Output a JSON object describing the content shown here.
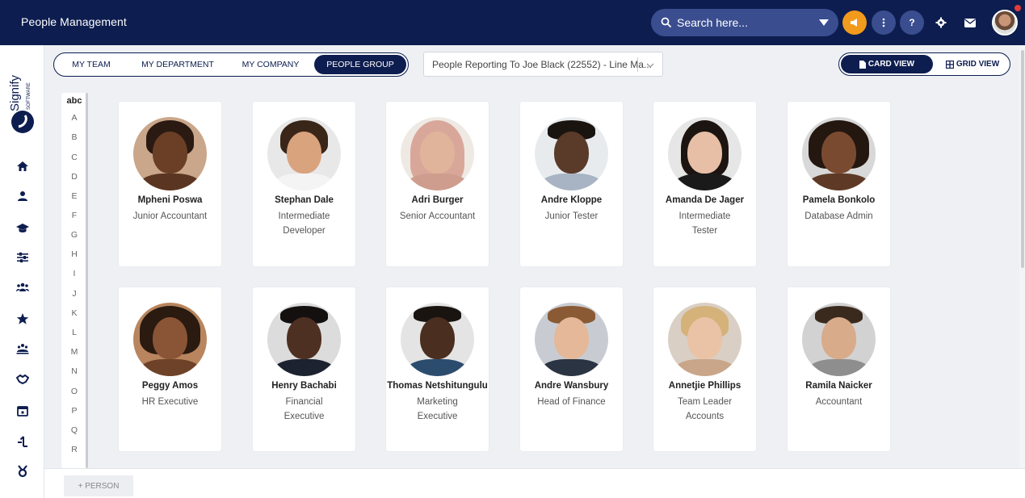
{
  "header": {
    "app_title": "People Management",
    "search_label": "Search here...",
    "colors": {
      "bar": "#0d1d4f",
      "search": "#3a4d8f",
      "accent": "#f29a1c",
      "circle": "#3a4d8f"
    },
    "icons": [
      "megaphone-icon",
      "more-vertical-icon",
      "help-icon",
      "gear-icon",
      "mail-icon"
    ]
  },
  "sidebar": {
    "logo_text": "Signify",
    "logo_sub": "SOFTWARE",
    "icons": [
      "home-icon",
      "person-icon",
      "graduation-cap-icon",
      "sliders-icon",
      "group-icon",
      "star-icon",
      "org-icon",
      "handshake-icon",
      "calendar-icon",
      "transfer-icon",
      "award-icon"
    ]
  },
  "tabs": [
    {
      "label": "MY TEAM"
    },
    {
      "label": "MY DEPARTMENT"
    },
    {
      "label": "MY COMPANY"
    },
    {
      "label": "PEOPLE GROUP",
      "active": true
    }
  ],
  "dropdown": {
    "value": "People Reporting To Joe Black (22552) - Line Ma..."
  },
  "view_toggle": {
    "card_view": "CARD VIEW",
    "grid_view": "GRID VIEW",
    "active": "card"
  },
  "alphabet": {
    "header": "abc",
    "letters": [
      "A",
      "B",
      "C",
      "D",
      "E",
      "F",
      "G",
      "H",
      "I",
      "J",
      "K",
      "L",
      "M",
      "N",
      "O",
      "P",
      "Q",
      "R"
    ]
  },
  "people": [
    {
      "name": "Mpheni Poswa",
      "title": "Junior Accountant"
    },
    {
      "name": "Stephan Dale",
      "title": "Intermediate Developer"
    },
    {
      "name": "Adri Burger",
      "title": "Senior Accountant"
    },
    {
      "name": "Andre Kloppe",
      "title": "Junior Tester"
    },
    {
      "name": "Amanda De Jager",
      "title": "Intermediate Tester"
    },
    {
      "name": "Pamela Bonkolo",
      "title": "Database Admin"
    },
    {
      "name": "Peggy Amos",
      "title": "HR Executive"
    },
    {
      "name": "Henry Bachabi",
      "title": "Financial Executive"
    },
    {
      "name": "Thomas Netshitungulu",
      "title": "Marketing Executive"
    },
    {
      "name": "Andre Wansbury",
      "title": "Head of Finance"
    },
    {
      "name": "Annetjie Phillips",
      "title": "Team Leader Accounts"
    },
    {
      "name": "Ramila Naicker",
      "title": "Accountant"
    }
  ],
  "footer": {
    "add_person": "+ PERSON"
  }
}
